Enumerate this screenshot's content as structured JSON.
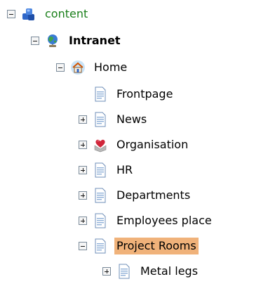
{
  "tree": {
    "root": {
      "label": "content",
      "color": "#1a7f1a",
      "expanded": true,
      "icon": "content-blocks-icon"
    },
    "site": {
      "label": "Intranet",
      "expanded": true,
      "icon": "globe-icon"
    },
    "home": {
      "label": "Home",
      "expanded": true,
      "icon": "home-icon"
    },
    "children": [
      {
        "label": "Frontpage",
        "icon": "page-icon",
        "expandable": false
      },
      {
        "label": "News",
        "icon": "page-icon",
        "expandable": true,
        "expanded": false
      },
      {
        "label": "Organisation",
        "icon": "heart-box-icon",
        "expandable": true,
        "expanded": false
      },
      {
        "label": "HR",
        "icon": "page-icon",
        "expandable": true,
        "expanded": false
      },
      {
        "label": "Departments",
        "icon": "page-icon",
        "expandable": true,
        "expanded": false
      },
      {
        "label": "Employees place",
        "icon": "page-icon",
        "expandable": true,
        "expanded": false
      },
      {
        "label": "Project Rooms",
        "icon": "page-icon",
        "expandable": true,
        "expanded": true,
        "selected": true,
        "highlight": "#f0b27a"
      }
    ],
    "grandchildren": [
      {
        "label": "Metal legs",
        "icon": "page-icon",
        "expandable": true,
        "expanded": false
      }
    ]
  }
}
